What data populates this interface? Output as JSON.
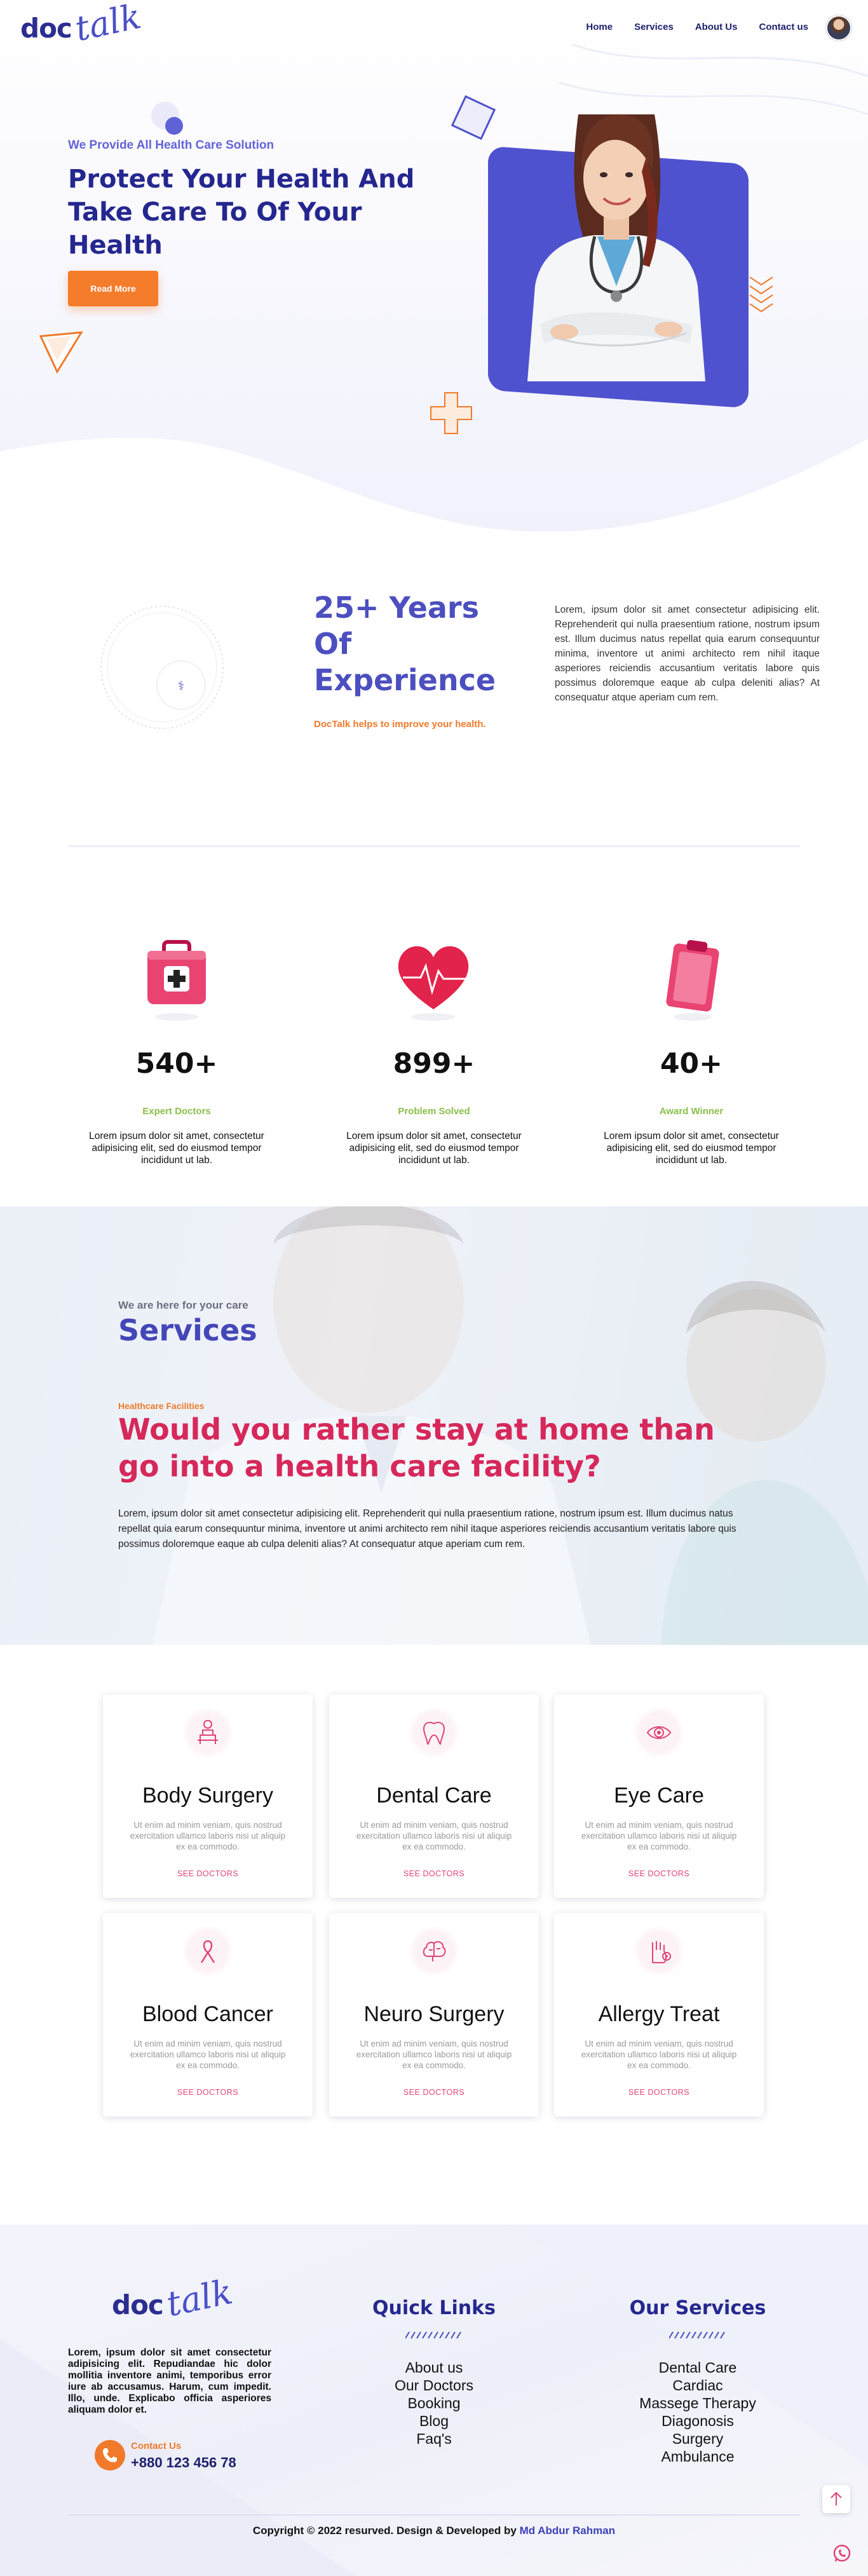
{
  "brand": {
    "logo_doc": "doc",
    "logo_talk": "talk"
  },
  "nav": {
    "items": [
      {
        "label": "Home"
      },
      {
        "label": "Services"
      },
      {
        "label": "About Us"
      },
      {
        "label": "Contact us"
      }
    ]
  },
  "hero": {
    "subtitle": "We Provide All Health Care Solution",
    "title": "Protect Your Health And Take Care To Of Your Health",
    "button": "Read More"
  },
  "experience": {
    "title": "25+ Years Of Experience",
    "subtitle": "DocTalk helps to improve your health.",
    "text": "Lorem, ipsum dolor sit amet consectetur adipisicing elit. Reprehenderit qui nulla praesentium ratione, nostrum ipsum est. Illum ducimus natus repellat quia earum consequuntur minima, inventore ut animi architecto rem nihil itaque asperiores reiciendis accusantium veritatis labore quis possimus doloremque eaque ab culpa deleniti alias? At consequatur atque aperiam cum rem."
  },
  "stats": [
    {
      "value": "540+",
      "label": "Expert Doctors",
      "desc": "Lorem ipsum dolor sit amet, consectetur adipisicing elit, sed do eiusmod tempor incididunt ut lab.",
      "icon": "first-aid-kit-icon"
    },
    {
      "value": "899+",
      "label": "Problem Solved",
      "desc": "Lorem ipsum dolor sit amet, consectetur adipisicing elit, sed do eiusmod tempor incididunt ut lab.",
      "icon": "heartbeat-icon"
    },
    {
      "value": "40+",
      "label": "Award Winner",
      "desc": "Lorem ipsum dolor sit amet, consectetur adipisicing elit, sed do eiusmod tempor incididunt ut lab.",
      "icon": "clipboard-icon"
    }
  ],
  "services_banner": {
    "subtitle": "We are here for your care",
    "title": "Services",
    "tag": "Healthcare Facilities",
    "heading": "Would you rather stay at home than go into a health care facility?",
    "text": "Lorem, ipsum dolor sit amet consectetur adipisicing elit. Reprehenderit qui nulla praesentium ratione, nostrum ipsum est. Illum ducimus natus repellat quia earum consequuntur minima, inventore ut animi architecto rem nihil itaque asperiores reiciendis accusantium veritatis labore quis possimus doloremque eaque ab culpa deleniti alias? At consequatur atque aperiam cum rem."
  },
  "service_cards": [
    {
      "title": "Body Surgery",
      "text": "Ut enim ad minim veniam, quis nostrud exercitation ullamco laboris nisi ut aliquip ex ea commodo.",
      "link": "SEE DOCTORS",
      "icon": "body-surgery-icon"
    },
    {
      "title": "Dental Care",
      "text": "Ut enim ad minim veniam, quis nostrud exercitation ullamco laboris nisi ut aliquip ex ea commodo.",
      "link": "SEE DOCTORS",
      "icon": "tooth-icon"
    },
    {
      "title": "Eye Care",
      "text": "Ut enim ad minim veniam, quis nostrud exercitation ullamco laboris nisi ut aliquip ex ea commodo.",
      "link": "SEE DOCTORS",
      "icon": "eye-icon"
    },
    {
      "title": "Blood Cancer",
      "text": "Ut enim ad minim veniam, quis nostrud exercitation ullamco laboris nisi ut aliquip ex ea commodo.",
      "link": "SEE DOCTORS",
      "icon": "cancer-ribbon-icon"
    },
    {
      "title": "Neuro Surgery",
      "text": "Ut enim ad minim veniam, quis nostrud exercitation ullamco laboris nisi ut aliquip ex ea commodo.",
      "link": "SEE DOCTORS",
      "icon": "brain-icon"
    },
    {
      "title": "Allergy Treat",
      "text": "Ut enim ad minim veniam, quis nostrud exercitation ullamco laboris nisi ut aliquip ex ea commodo.",
      "link": "SEE DOCTORS",
      "icon": "allergy-hand-icon"
    }
  ],
  "footer": {
    "about": "Lorem, ipsum dolor sit amet consectetur adipisicing elit. Repudiandae hic dolor mollitia inventore animi, temporibus error iure ab accusamus. Harum, cum impedit. Illo, unde. Explicabo officia asperiores aliquam dolor et.",
    "contact_label": "Contact Us",
    "contact_number": "+880 123 456 78",
    "quick_links_title": "Quick Links",
    "quick_links": [
      "About us",
      "Our Doctors",
      "Booking",
      "Blog",
      "Faq's"
    ],
    "services_title": "Our Services",
    "services": [
      "Dental Care",
      "Cardiac",
      "Massege Therapy",
      "Diagonosis",
      "Surgery",
      "Ambulance"
    ],
    "copyright": "Copyright © 2022 resurved. Design & Developed by",
    "author": "Md Abdur Rahman"
  },
  "colors": {
    "primary": "#25278f",
    "accent_purple": "#4f52cf",
    "accent_orange": "#f07a2a",
    "accent_pink": "#d6285a",
    "stat_green": "#8bbf4a"
  }
}
